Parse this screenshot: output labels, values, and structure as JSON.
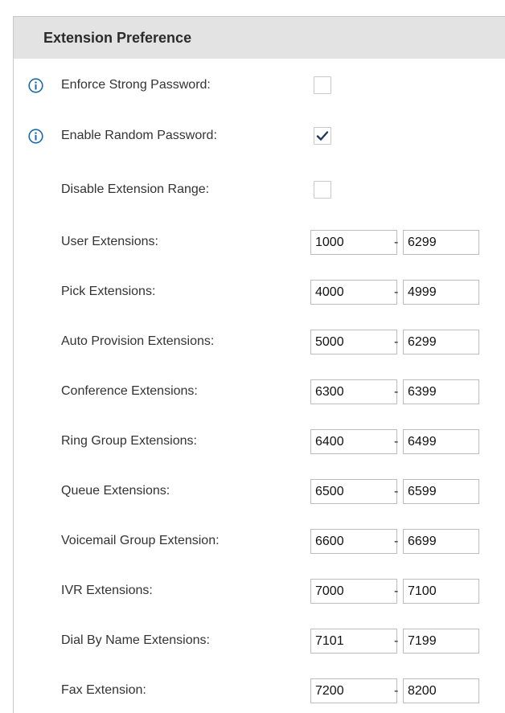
{
  "section": {
    "title": "Extension Preference"
  },
  "settings": {
    "enforce_strong_password": {
      "label": "Enforce Strong Password:",
      "checked": false
    },
    "enable_random_password": {
      "label": "Enable Random Password:",
      "checked": true
    },
    "disable_extension_range": {
      "label": "Disable Extension Range:",
      "checked": false
    }
  },
  "ranges": [
    {
      "label": "User Extensions:",
      "start": "1000",
      "end": "6299"
    },
    {
      "label": "Pick Extensions:",
      "start": "4000",
      "end": "4999"
    },
    {
      "label": "Auto Provision Extensions:",
      "start": "5000",
      "end": "6299"
    },
    {
      "label": "Conference Extensions:",
      "start": "6300",
      "end": "6399"
    },
    {
      "label": "Ring Group Extensions:",
      "start": "6400",
      "end": "6499"
    },
    {
      "label": "Queue Extensions:",
      "start": "6500",
      "end": "6599"
    },
    {
      "label": "Voicemail Group Extension:",
      "start": "6600",
      "end": "6699"
    },
    {
      "label": "IVR Extensions:",
      "start": "7000",
      "end": "7100"
    },
    {
      "label": "Dial By Name Extensions:",
      "start": "7101",
      "end": "7199"
    },
    {
      "label": "Fax Extension:",
      "start": "7200",
      "end": "8200"
    }
  ],
  "range_separator": "-",
  "icons": {
    "info": "info-circle-icon",
    "check": "checkmark-icon"
  },
  "colors": {
    "info_icon": "#1a6aa8",
    "header_bg": "#e3e3e3",
    "checkmark": "#1f3a5a"
  }
}
